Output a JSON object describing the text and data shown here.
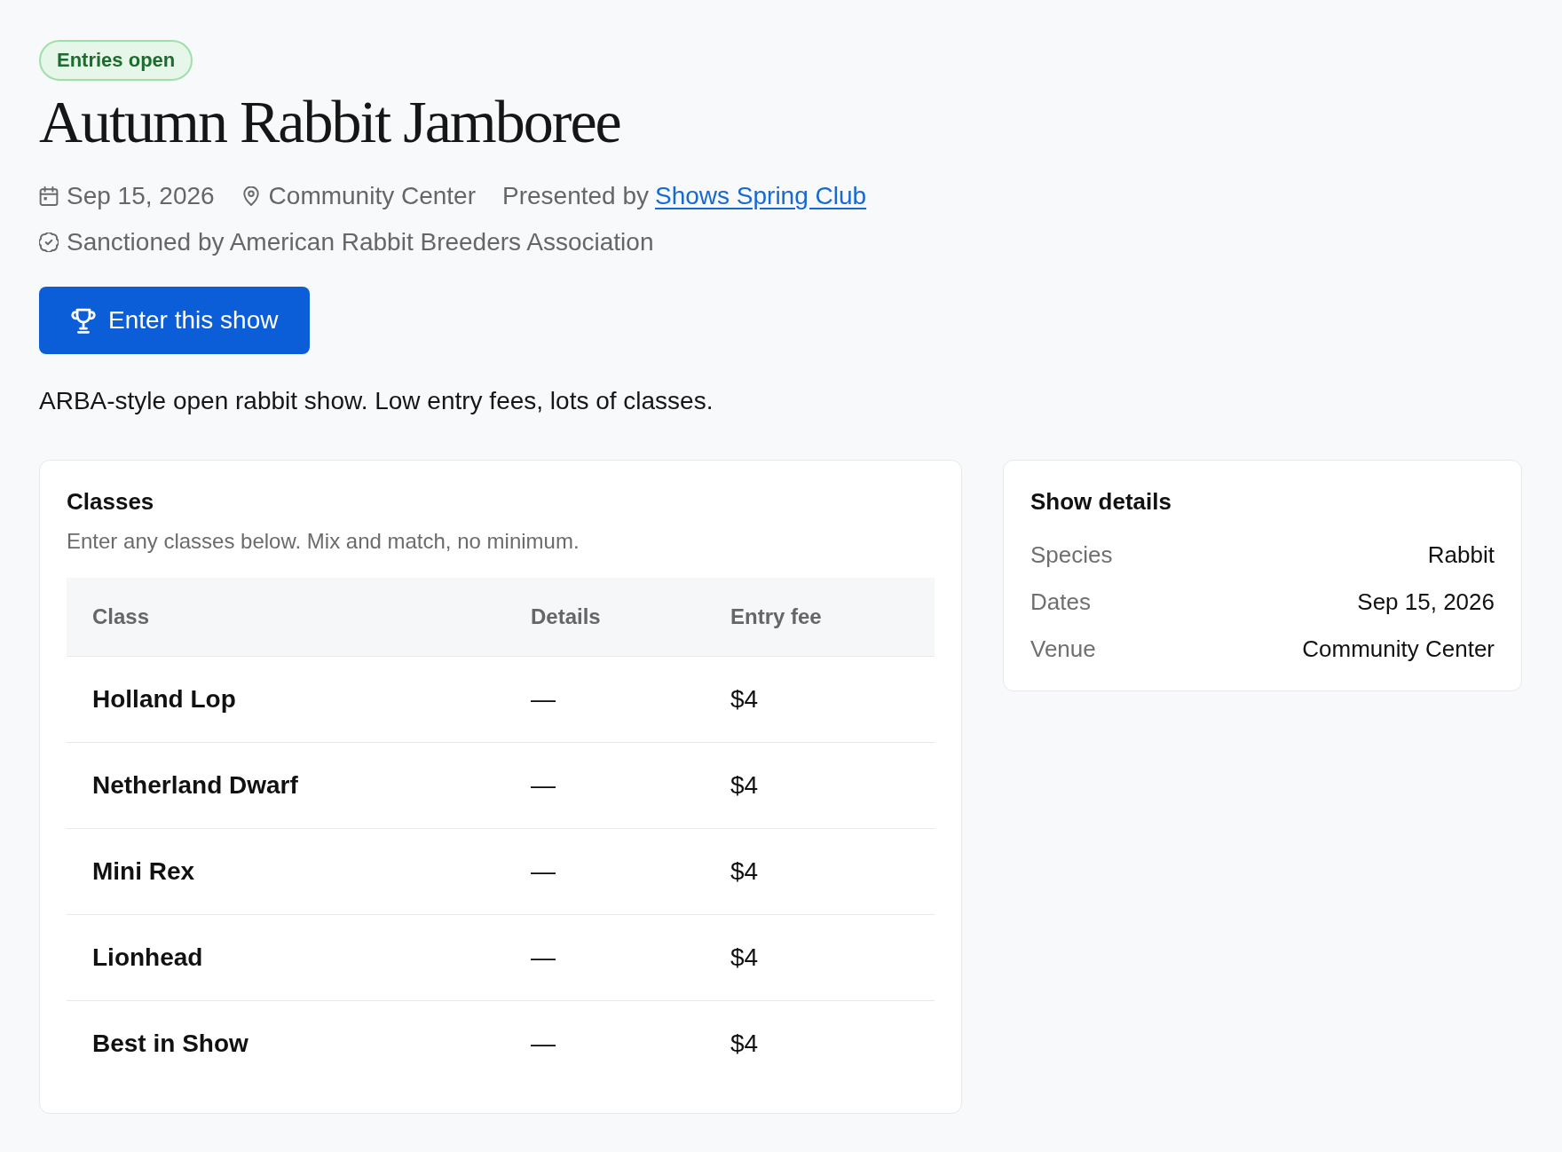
{
  "status_badge": {
    "label": "Entries open"
  },
  "title": "Autumn Rabbit Jamboree",
  "meta": {
    "date": "Sep 15, 2026",
    "venue": "Community Center",
    "presenter_prefix": "Presented by",
    "presenter_link": "Shows Spring Club",
    "sanction": "Sanctioned by American Rabbit Breeders Association"
  },
  "primary_button": {
    "label": "Enter this show"
  },
  "description": "ARBA-style open rabbit show. Low entry fees, lots of classes.",
  "classes": {
    "title": "Classes",
    "subtitle": "Enter any classes below. Mix and match, no minimum.",
    "columns": [
      "Class",
      "Details",
      "Entry fee"
    ],
    "rows": [
      {
        "class": "Holland Lop",
        "details": "—",
        "fee": "$4"
      },
      {
        "class": "Netherland Dwarf",
        "details": "—",
        "fee": "$4"
      },
      {
        "class": "Mini Rex",
        "details": "—",
        "fee": "$4"
      },
      {
        "class": "Lionhead",
        "details": "—",
        "fee": "$4"
      },
      {
        "class": "Best in Show",
        "details": "—",
        "fee": "$4"
      }
    ]
  },
  "show_details": {
    "title": "Show details",
    "rows": [
      {
        "label": "Species",
        "value": "Rabbit"
      },
      {
        "label": "Dates",
        "value": "Sep 15, 2026"
      },
      {
        "label": "Venue",
        "value": "Community Center"
      }
    ]
  }
}
